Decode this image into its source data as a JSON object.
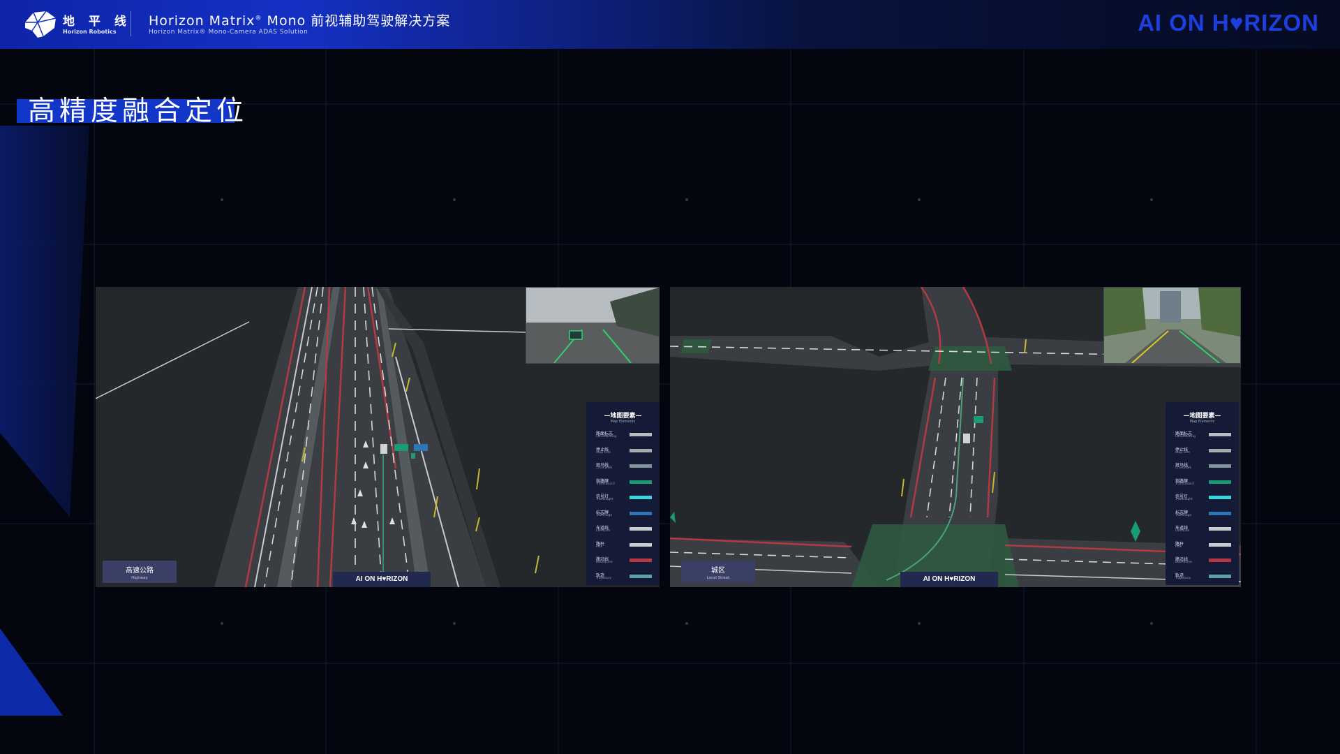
{
  "header": {
    "brand_cn": "地 平 线",
    "brand_en": "Horizon Robotics",
    "title_main": "Horizon Matrix",
    "title_reg": "®",
    "title_rest": " Mono 前视辅助驾驶解决方案",
    "subtitle": "Horizon Matrix®  Mono-Camera ADAS Solution",
    "right_brand": "AI ON H♥RIZON"
  },
  "slide": {
    "title": "高精度融合定位"
  },
  "panels": {
    "left": {
      "road_type_cn": "高速公路",
      "road_type_en": "Highway",
      "watermark": "AI ON H♥RIZON"
    },
    "right": {
      "road_type_cn": "城区",
      "road_type_en": "Local Street",
      "watermark": "AI ON H♥RIZON"
    }
  },
  "legend": {
    "title": "—地图要素—",
    "subtitle": "Map Elements",
    "items": [
      {
        "cn": "路面标志",
        "en": "LaneMarking",
        "color": "#b9bcc0"
      },
      {
        "cn": "停止线",
        "en": "Stop Line",
        "color": "#a7aaae"
      },
      {
        "cn": "斑马线",
        "en": "CrossWalk",
        "color": "#7e9498"
      },
      {
        "cn": "指路牌",
        "en": "TrafficBoard",
        "color": "#1b9a76"
      },
      {
        "cn": "信号灯",
        "en": "TrafficLight",
        "color": "#38d5dc"
      },
      {
        "cn": "标志牌",
        "en": "TrafficSign",
        "color": "#2f76b7"
      },
      {
        "cn": "车道线",
        "en": "LaneLine",
        "color": "#c9ccd0"
      },
      {
        "cn": "路杆",
        "en": "Pole",
        "color": "#c9ccd0"
      },
      {
        "cn": "路沿线",
        "en": "BoundLine",
        "color": "#b23a44"
      },
      {
        "cn": "轨迹",
        "en": "Trajectory",
        "color": "#5da0a6"
      }
    ]
  }
}
